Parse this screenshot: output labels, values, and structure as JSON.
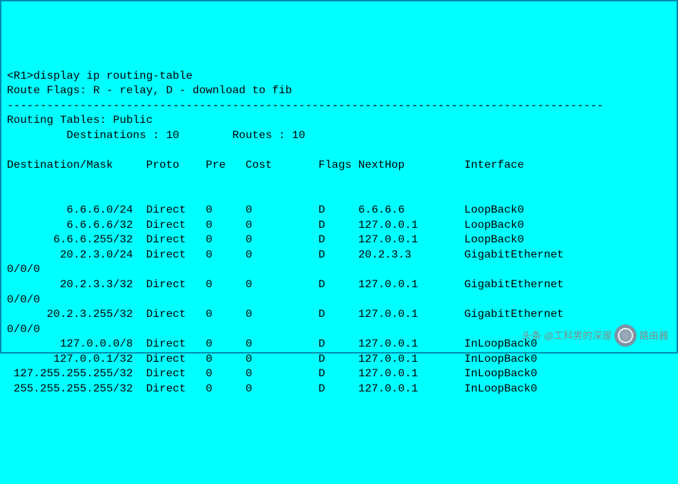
{
  "prompt": "<R1>display ip routing-table",
  "flags_line": "Route Flags: R - relay, D - download to fib",
  "hr": "------------------------------------------------------------------------------------------",
  "tables_title": "Routing Tables: Public",
  "summary": {
    "destinations_label": "Destinations :",
    "destinations": 10,
    "routes_label": "Routes :",
    "routes": 10
  },
  "columns": {
    "dest": "Destination/Mask",
    "proto": "Proto",
    "pre": "Pre",
    "cost": "Cost",
    "flags": "Flags",
    "nexthop": "NextHop",
    "iface": "Interface"
  },
  "routes": [
    {
      "dest": "6.6.6.0/24",
      "proto": "Direct",
      "pre": 0,
      "cost": 0,
      "flags": "D",
      "nexthop": "6.6.6.6",
      "iface": "LoopBack0"
    },
    {
      "dest": "6.6.6.6/32",
      "proto": "Direct",
      "pre": 0,
      "cost": 0,
      "flags": "D",
      "nexthop": "127.0.0.1",
      "iface": "LoopBack0"
    },
    {
      "dest": "6.6.6.255/32",
      "proto": "Direct",
      "pre": 0,
      "cost": 0,
      "flags": "D",
      "nexthop": "127.0.0.1",
      "iface": "LoopBack0"
    },
    {
      "dest": "20.2.3.0/24",
      "proto": "Direct",
      "pre": 0,
      "cost": 0,
      "flags": "D",
      "nexthop": "20.2.3.3",
      "iface": "GigabitEthernet",
      "continuation": "0/0/0"
    },
    {
      "dest": "20.2.3.3/32",
      "proto": "Direct",
      "pre": 0,
      "cost": 0,
      "flags": "D",
      "nexthop": "127.0.0.1",
      "iface": "GigabitEthernet",
      "continuation": "0/0/0"
    },
    {
      "dest": "20.2.3.255/32",
      "proto": "Direct",
      "pre": 0,
      "cost": 0,
      "flags": "D",
      "nexthop": "127.0.0.1",
      "iface": "GigabitEthernet",
      "continuation": "0/0/0"
    },
    {
      "dest": "127.0.0.0/8",
      "proto": "Direct",
      "pre": 0,
      "cost": 0,
      "flags": "D",
      "nexthop": "127.0.0.1",
      "iface": "InLoopBack0"
    },
    {
      "dest": "127.0.0.1/32",
      "proto": "Direct",
      "pre": 0,
      "cost": 0,
      "flags": "D",
      "nexthop": "127.0.0.1",
      "iface": "InLoopBack0"
    },
    {
      "dest": "127.255.255.255/32",
      "proto": "Direct",
      "pre": 0,
      "cost": 0,
      "flags": "D",
      "nexthop": "127.0.0.1",
      "iface": "InLoopBack0"
    },
    {
      "dest": "255.255.255.255/32",
      "proto": "Direct",
      "pre": 0,
      "cost": 0,
      "flags": "D",
      "nexthop": "127.0.0.1",
      "iface": "InLoopBack0"
    }
  ],
  "watermark": {
    "prefix": "头条",
    "author": "@工科男的深邃",
    "brand": "路由器"
  }
}
